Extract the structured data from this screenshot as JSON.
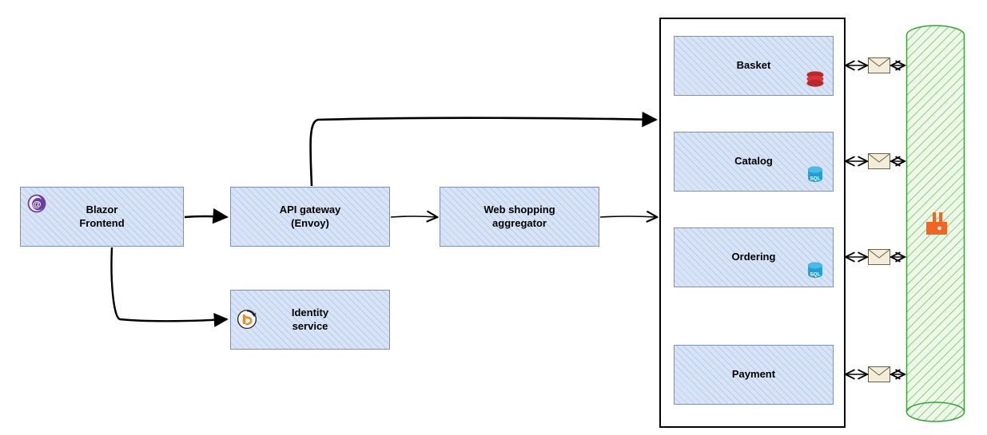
{
  "nodes": {
    "frontend": {
      "label": "Blazor\nFrontend",
      "icon": "blazor"
    },
    "gateway": {
      "label": "API gateway\n(Envoy)"
    },
    "identity": {
      "label": "Identity\nservice",
      "icon": "identity"
    },
    "aggregator": {
      "label": "Web shopping\naggregator"
    }
  },
  "services": [
    {
      "id": "basket",
      "label": "Basket",
      "store": "redis"
    },
    {
      "id": "catalog",
      "label": "Catalog",
      "store": "sql"
    },
    {
      "id": "ordering",
      "label": "Ordering",
      "store": "sql"
    },
    {
      "id": "payment",
      "label": "Payment",
      "store": null
    }
  ],
  "event_bus": {
    "broker": "rabbitmq"
  },
  "colors": {
    "node_fill": "#d7e3f7",
    "node_border": "#7a90c2",
    "bus_stroke": "#3aa33a",
    "bus_fill": "#e9f6e0",
    "envelope_fill": "#f3ecd9",
    "rabbit": "#f26522",
    "redis": "#b9282b",
    "sql": "#1f9fd6",
    "blazor": "#6b3fa0"
  }
}
